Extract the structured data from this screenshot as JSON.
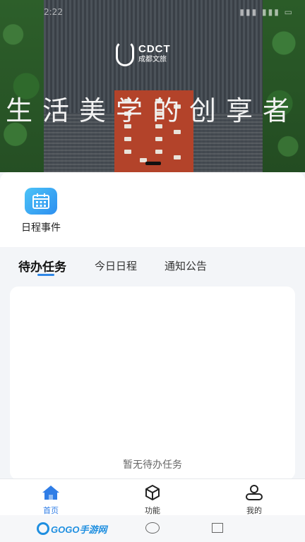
{
  "banner": {
    "logo_en": "CDCT",
    "logo_cn": "成都文旅",
    "tagline": "生活美学的创享者"
  },
  "quick_entries": [
    {
      "label": "日程事件",
      "icon": "calendar-icon"
    }
  ],
  "tabs": [
    {
      "label": "待办任务",
      "active": true
    },
    {
      "label": "今日日程",
      "active": false
    },
    {
      "label": "通知公告",
      "active": false
    }
  ],
  "task_panel": {
    "empty_text": "暂无待办任务"
  },
  "bottom_nav": [
    {
      "label": "首页",
      "icon": "home-icon",
      "active": true
    },
    {
      "label": "功能",
      "icon": "cube-icon",
      "active": false
    },
    {
      "label": "我的",
      "icon": "user-icon",
      "active": false
    }
  ],
  "watermark": {
    "text": "GOGO手游网"
  },
  "colors": {
    "accent": "#2f7de6",
    "entry_icon_from": "#4cc3f7",
    "entry_icon_to": "#2d8ff0",
    "page_bg": "#f3f5f8"
  }
}
